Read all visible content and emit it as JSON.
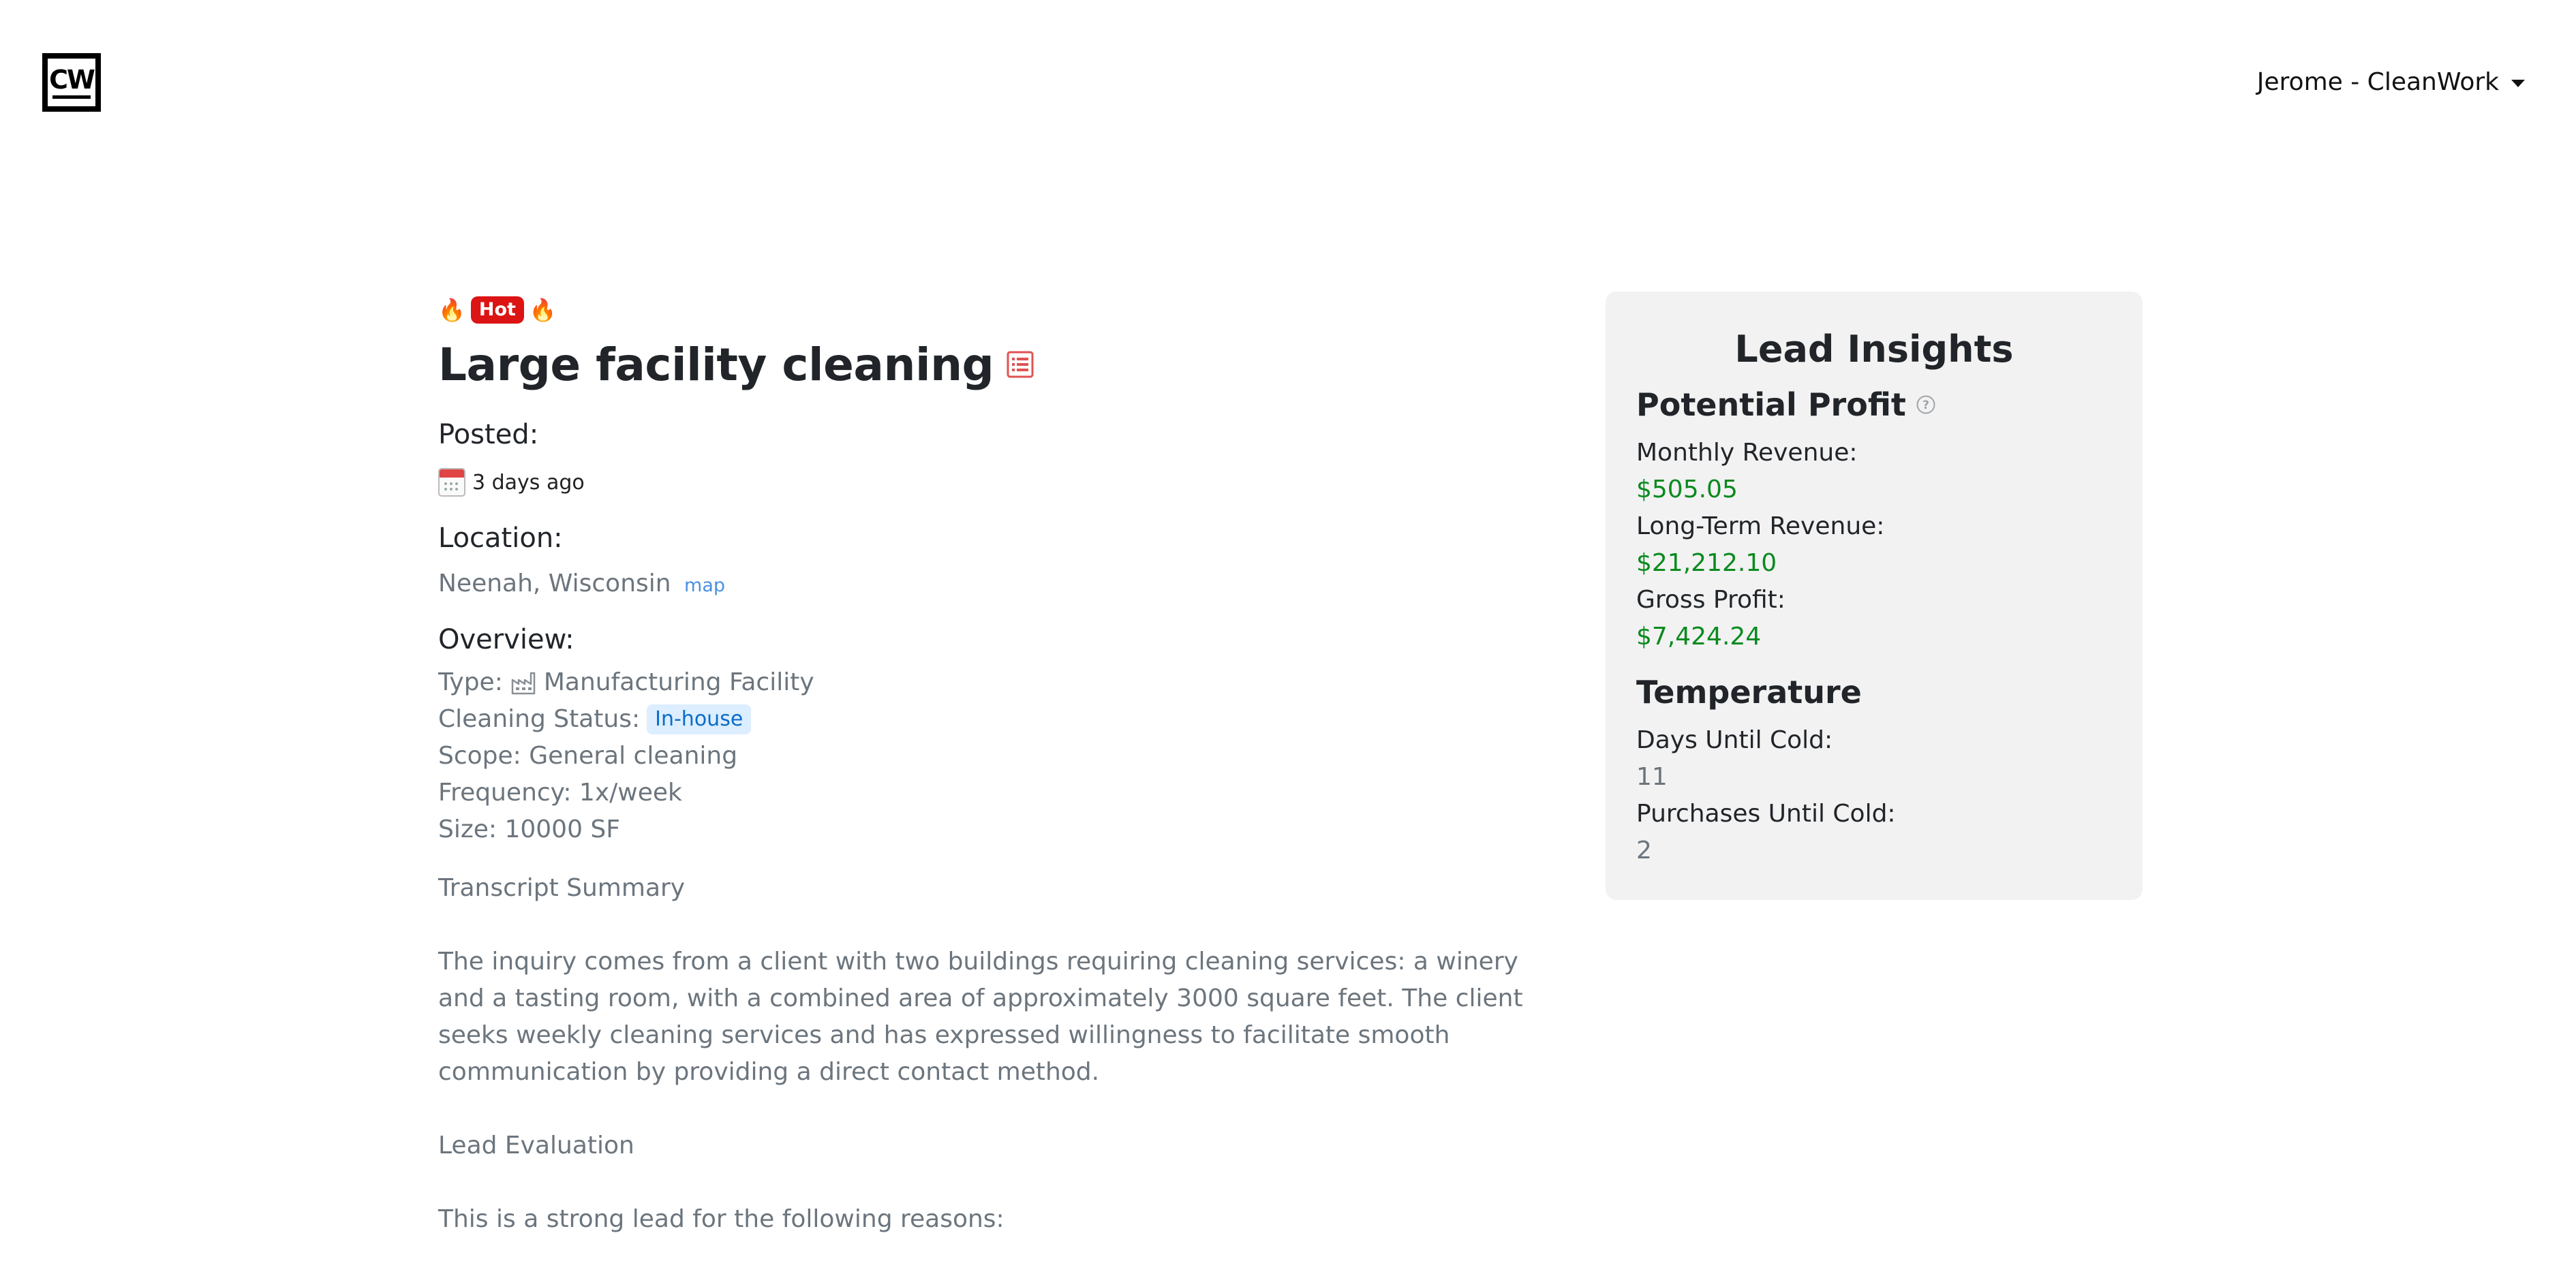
{
  "header": {
    "logo_text": "CW",
    "user_menu_label": "Jerome - CleanWork"
  },
  "lead": {
    "badge": "Hot",
    "title": "Large facility cleaning",
    "posted_label": "Posted:",
    "posted_value": "3 days ago",
    "location_label": "Location:",
    "location_value": "Neenah, Wisconsin",
    "map_link": "map",
    "overview_label": "Overview:",
    "type_label": "Type:",
    "type_value": "Manufacturing Facility",
    "cleaning_status_label": "Cleaning Status:",
    "cleaning_status_value": "In-house",
    "scope": "Scope: General cleaning",
    "frequency": "Frequency: 1x/week",
    "size": "Size: 10000 SF",
    "transcript_heading": "Transcript Summary",
    "transcript_body": "The inquiry comes from a client with two buildings requiring cleaning services: a winery and a tasting room, with a combined area of approximately 3000 square feet. The client seeks weekly cleaning services and has expressed willingness to facilitate smooth communication by providing a direct contact method.",
    "evaluation_heading": "Lead Evaluation",
    "evaluation_body": "This is a strong lead for the following reasons:"
  },
  "insights": {
    "title": "Lead Insights",
    "potential_profit_heading": "Potential Profit",
    "monthly_revenue_label": "Monthly Revenue:",
    "monthly_revenue_value": "$505.05",
    "long_term_revenue_label": "Long-Term Revenue:",
    "long_term_revenue_value": "$21,212.10",
    "gross_profit_label": "Gross Profit:",
    "gross_profit_value": "$7,424.24",
    "temperature_heading": "Temperature",
    "days_until_cold_label": "Days Until Cold:",
    "days_until_cold_value": "11",
    "purchases_until_cold_label": "Purchases Until Cold:",
    "purchases_until_cold_value": "2"
  },
  "colors": {
    "hot_badge": "#dc1414",
    "status_badge_bg": "#dceeff",
    "status_badge_text": "#0b6cc9",
    "money_green": "#0a8a1f",
    "card_bg": "#f2f2f2"
  },
  "icons": {
    "logo": "cw-logo-icon",
    "caret": "caret-down-icon",
    "flame": "flame-icon",
    "list": "list-document-icon",
    "calendar": "calendar-icon",
    "factory": "factory-icon",
    "help": "help-circle-icon"
  }
}
